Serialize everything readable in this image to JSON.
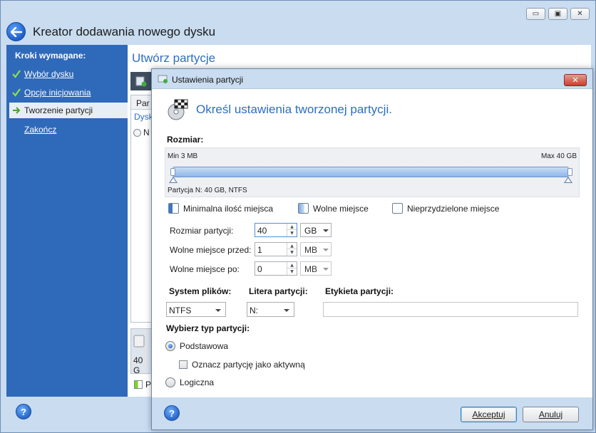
{
  "window": {
    "title": "Kreator dodawania nowego dysku",
    "minimize_icon": "minimize-icon",
    "maximize_icon": "maximize-icon",
    "close_icon": "close-icon"
  },
  "sidebar": {
    "heading": "Kroki wymagane:",
    "steps": [
      {
        "label": "Wybór dysku",
        "state": "done"
      },
      {
        "label": "Opcje inicjowania",
        "state": "done"
      },
      {
        "label": "Tworzenie partycji",
        "state": "current"
      },
      {
        "label": "Zakończ",
        "state": "pending"
      }
    ]
  },
  "main": {
    "title": "Utwórz partycje",
    "table_header": "Par",
    "table_sub": "Dysk",
    "row_label": "N",
    "disk_size": "40 G",
    "legend_label": "P"
  },
  "dialog": {
    "title": "Ustawienia partycji",
    "heading": "Określ ustawienia tworzonej partycji.",
    "size_label": "Rozmiar:",
    "size_min": "Min 3 MB",
    "size_max": "Max 40 GB",
    "partition_caption": "Partycja N: 40 GB, NTFS",
    "slider_fill_fraction": 1.0,
    "legend": {
      "min_space": "Minimalna ilość miejsca",
      "free_space": "Wolne miejsce",
      "unallocated": "Nieprzydzielone miejsce"
    },
    "fields": {
      "partition_size": {
        "label": "Rozmiar partycji:",
        "value": "40",
        "unit": "GB"
      },
      "free_before": {
        "label": "Wolne miejsce przed:",
        "value": "1",
        "unit": "MB"
      },
      "free_after": {
        "label": "Wolne miejsce po:",
        "value": "0",
        "unit": "MB"
      }
    },
    "file_system": {
      "label": "System plików:",
      "value": "NTFS"
    },
    "drive_letter": {
      "label": "Litera partycji:",
      "value": "N:"
    },
    "volume_label": {
      "label": "Etykieta partycji:",
      "value": ""
    },
    "partition_type": {
      "label": "Wybierz typ partycji:",
      "primary": "Podstawowa",
      "mark_active": "Oznacz partycję jako aktywną",
      "logical": "Logiczna",
      "selected": "primary"
    },
    "buttons": {
      "ok": "Akceptuj",
      "cancel": "Anuluj"
    }
  },
  "colors": {
    "accent_blue": "#2d6ec2",
    "sidebar_bg": "#2f69b9",
    "chrome_bg": "#c9dcf0",
    "check_green": "#7ed321"
  }
}
